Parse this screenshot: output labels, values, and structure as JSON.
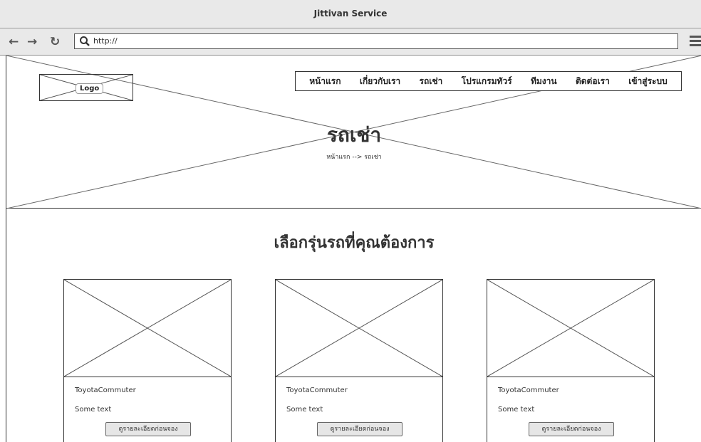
{
  "window": {
    "title": "Jittivan Service"
  },
  "toolbar": {
    "url": "http://"
  },
  "header": {
    "logo_label": "Logo",
    "nav": [
      "หน้าแรก",
      "เกี่ยวกับเรา",
      "รถเช่า",
      "โปรแกรมทัวร์",
      "ทีมงาน",
      "ติดต่อเรา",
      "เข้าสู่ระบบ"
    ],
    "title": "รถเช่า",
    "breadcrumb": "หน้าแรก --> รถเช่า"
  },
  "main": {
    "section_title": "เลือกรุ่นรถที่คุณต้องการ",
    "cards": [
      {
        "name": "ToyotaCommuter",
        "text": "Some text",
        "button": "ดูรายละเอียดก่อนจอง"
      },
      {
        "name": "ToyotaCommuter",
        "text": "Some text",
        "button": "ดูรายละเอียดก่อนจอง"
      },
      {
        "name": "ToyotaCommuter",
        "text": "Some text",
        "button": "ดูรายละเอียดก่อนจอง"
      }
    ]
  },
  "icons": [
    "back-arrow-icon",
    "forward-arrow-icon",
    "reload-icon",
    "search-icon",
    "hamburger-menu-icon",
    "image-placeholder-icon"
  ]
}
